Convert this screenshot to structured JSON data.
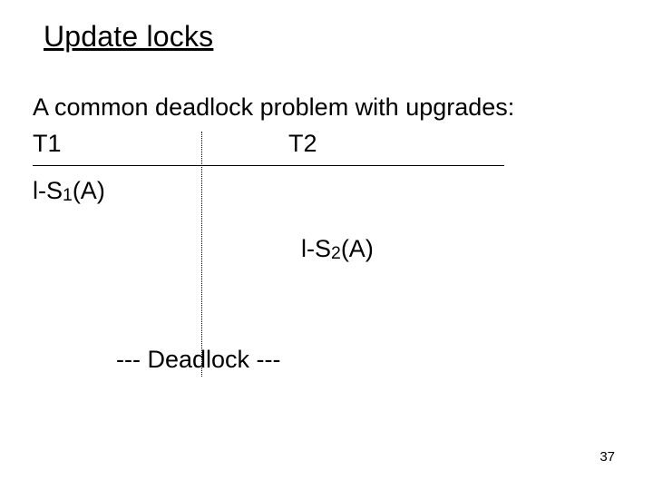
{
  "title": "Update locks",
  "intro": "A common deadlock problem with upgrades:",
  "columns": {
    "t1": "T1",
    "t2": "T2"
  },
  "rows": {
    "ls1_prefix": "l-S",
    "ls1_sub": "1",
    "ls1_suffix": "(A)",
    "ls2_prefix": "l-S",
    "ls2_sub": "2",
    "ls2_suffix": "(A)"
  },
  "deadlock": "--- Deadlock ---",
  "page": "37"
}
